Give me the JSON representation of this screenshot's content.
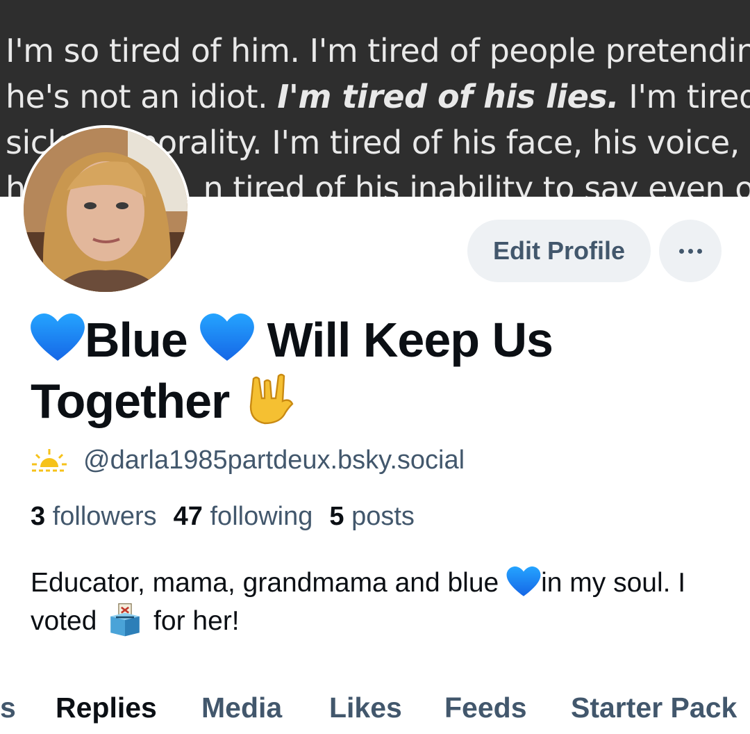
{
  "banner": {
    "lines": [
      "I'm so tired of him. I'm tired of people pretending",
      "he's not an idiot. ",
      "I'm tired of his lies.",
      " I'm tired of his",
      "sick",
      "morality. I'm tired of his face, his voice,",
      "h",
      "n tired of his inability to say even one"
    ]
  },
  "profile": {
    "edit_label": "Edit Profile",
    "display_name_part1": "Blue ",
    "display_name_part2": " Will Keep Us Together ",
    "handle": "@darla1985partdeux.bsky.social",
    "followers_count": "3",
    "followers_label": "followers",
    "following_count": "47",
    "following_label": "following",
    "posts_count": "5",
    "posts_label": "posts",
    "bio_part1": "Educator, mama, grandmama and blue ",
    "bio_part2": "in my soul. I voted ",
    "bio_part3": " for her!"
  },
  "tabs": [
    "s",
    "Replies",
    "Media",
    "Likes",
    "Feeds",
    "Starter Pack"
  ],
  "active_tab": "Replies",
  "icons": [
    "blue-heart-icon",
    "rock-hand-icon",
    "sunrise-icon",
    "ballot-box-icon",
    "more-options-icon"
  ],
  "colors": {
    "accent_text": "#42576c",
    "button_bg": "#eef1f4",
    "heart": "#1d8cf8"
  }
}
